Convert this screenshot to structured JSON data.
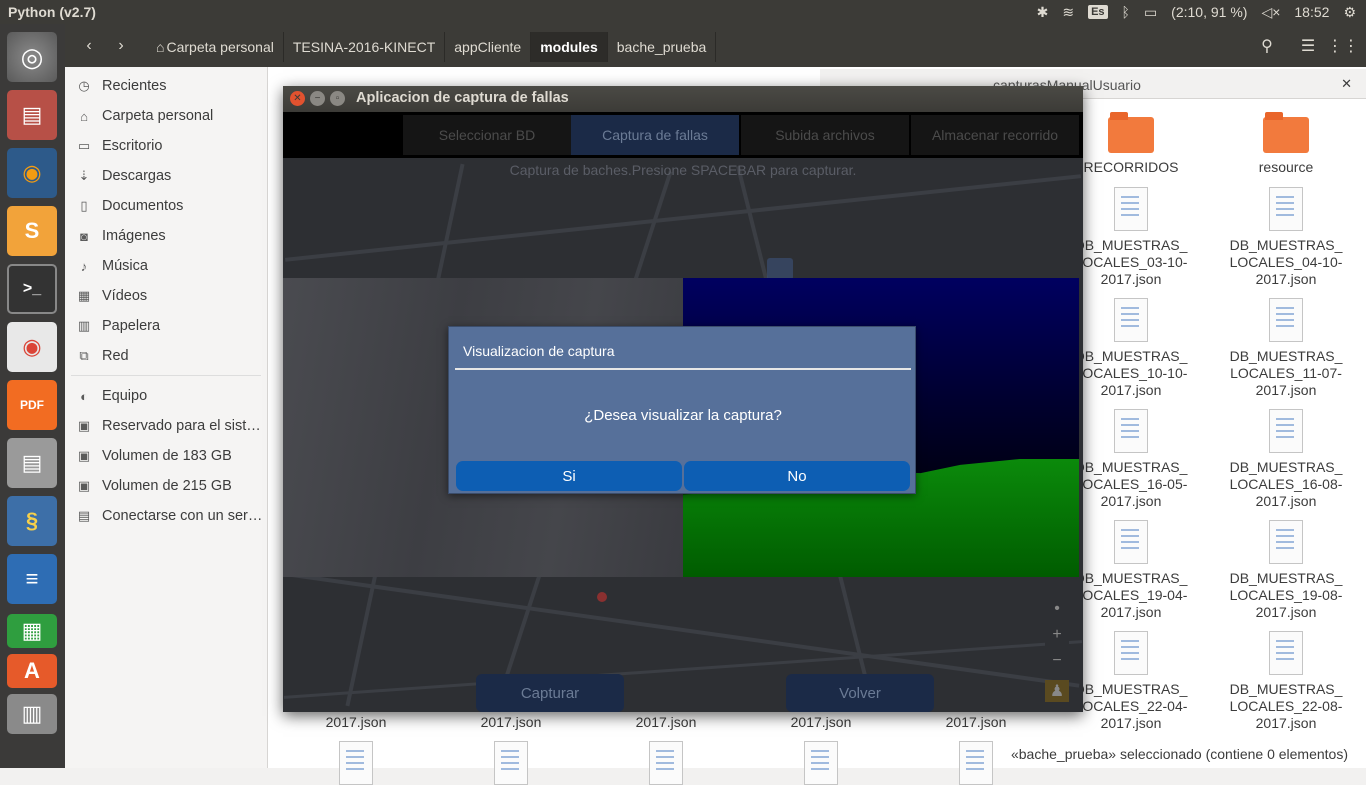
{
  "topbar": {
    "app_title": "Python (v2.7)",
    "keyboard_layout": "Es",
    "battery": "(2:10, 91 %)",
    "clock": "18:52"
  },
  "launcher": {
    "icons": [
      "ubuntu-dash-icon",
      "files-icon",
      "firefox-icon",
      "sublime-text-icon",
      "terminal-icon",
      "chrome-icon",
      "pdf-editor-icon",
      "files-icon",
      "python-icon",
      "writer-icon",
      "calc-icon",
      "impress-icon",
      "trash-icon"
    ]
  },
  "files": {
    "breadcrumbs": [
      "Carpeta personal",
      "TESINA-2016-KINECT",
      "appCliente",
      "modules",
      "bache_prueba"
    ],
    "active_crumb": "modules",
    "sidebar": [
      {
        "label": "Recientes",
        "icon": "clock-icon"
      },
      {
        "label": "Carpeta personal",
        "icon": "home-icon"
      },
      {
        "label": "Escritorio",
        "icon": "desktop-icon"
      },
      {
        "label": "Descargas",
        "icon": "download-icon"
      },
      {
        "label": "Documentos",
        "icon": "document-icon"
      },
      {
        "label": "Imágenes",
        "icon": "camera-icon"
      },
      {
        "label": "Música",
        "icon": "music-icon"
      },
      {
        "label": "Vídeos",
        "icon": "film-icon"
      },
      {
        "label": "Papelera",
        "icon": "trash-icon"
      },
      {
        "label": "Red",
        "icon": "network-icon"
      },
      {
        "label": "Equipo",
        "icon": "computer-icon"
      },
      {
        "label": "Reservado para el sist…",
        "icon": "drive-icon"
      },
      {
        "label": "Volumen de 183 GB",
        "icon": "drive-icon"
      },
      {
        "label": "Volumen de 215 GB",
        "icon": "drive-icon"
      },
      {
        "label": "Conectarse con un ser…",
        "icon": "server-icon"
      }
    ],
    "background_tab": "capturasManualUsuario",
    "items_right": [
      [
        "RECORRIDOS",
        "resource"
      ],
      [
        "DB_MUESTRAS_ LOCALES_03-10- 2017.json",
        "DB_MUESTRAS_ LOCALES_04-10- 2017.json"
      ],
      [
        "DB_MUESTRAS_ LOCALES_10-10- 2017.json",
        "DB_MUESTRAS_ LOCALES_11-07- 2017.json"
      ],
      [
        "DB_MUESTRAS_ LOCALES_16-05- 2017.json",
        "DB_MUESTRAS_ LOCALES_16-08- 2017.json"
      ],
      [
        "DB_MUESTRAS_ LOCALES_19-04- 2017.json",
        "DB_MUESTRAS_ LOCALES_19-08- 2017.json"
      ],
      [
        "DB_MUESTRAS_ LOCALES_22-04- 2017.json",
        "DB_MUESTRAS_ LOCALES_22-08- 2017.json"
      ]
    ],
    "bottom_row": [
      "2017.json",
      "2017.json",
      "2017.json",
      "2017.json",
      "2017.json"
    ],
    "status": "«bache_prueba» seleccionado  (contiene 0 elementos)"
  },
  "app": {
    "title": "Aplicacion de captura de fallas",
    "tabs": [
      "Seleccionar BD",
      "Captura de fallas",
      "Subida archivos",
      "Almacenar recorrido"
    ],
    "active_tab": "Captura de fallas",
    "info": "Captura de baches.Presione SPACEBAR para capturar.",
    "capture_button": "Capturar",
    "back_button": "Volver",
    "zoom_in": "+",
    "zoom_out": "−"
  },
  "dialog": {
    "title": "Visualizacion de captura",
    "message": "¿Desea visualizar la captura?",
    "yes": "Si",
    "no": "No"
  },
  "colors": {
    "dialog_bg": "#56709a",
    "dialog_button": "#0d5eb3",
    "folder": "#f27a3d",
    "depth_green": "#0b8a0b"
  }
}
